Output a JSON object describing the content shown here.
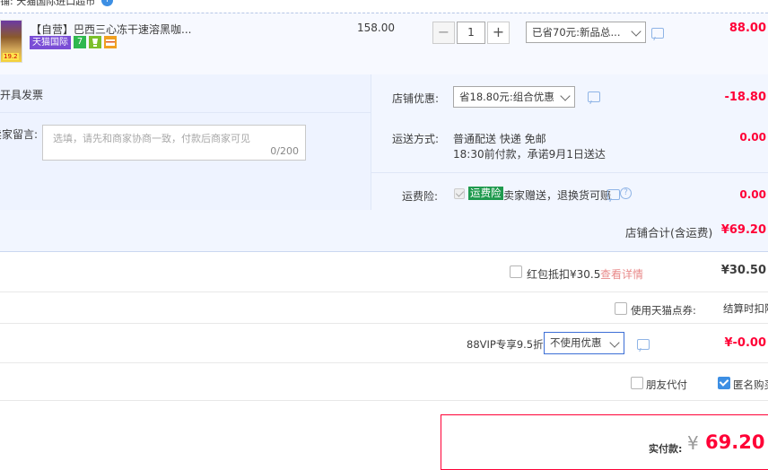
{
  "shop": {
    "label": "铺: 天猫国际进口超市",
    "info_glyph": "i"
  },
  "item": {
    "thumb_tag": "19.2",
    "title": "【自营】巴西三心冻干速溶黑咖...",
    "badge_tmall": "天猫国际",
    "badge_icons": [
      "7",
      "cup",
      "card"
    ],
    "unit_price": "158.00",
    "quantity": "1",
    "minus": "−",
    "plus": "+",
    "discount_select": "已省70元:新品总...",
    "subtotal": "88.00"
  },
  "invoice": {
    "label": "开具发票"
  },
  "message": {
    "label": "卖家留言:",
    "placeholder": "选填，请先和商家协商一致，付款后商家可见",
    "counter": "0/200"
  },
  "shop_promo": {
    "label": "店铺优惠:",
    "select": "省18.80元:组合优惠",
    "amount": "-18.80"
  },
  "shipping": {
    "label": "运送方式:",
    "method": "普通配送 快递 免邮",
    "promise": "18:30前付款，承诺9月1日送达",
    "amount": "0.00"
  },
  "insurance": {
    "label": "运费险:",
    "tag": "运费险",
    "desc": "卖家赠送，退换货可赔",
    "amount": "0.00"
  },
  "shop_total": {
    "label": "店铺合计(含运费)",
    "amount": "¥69.20"
  },
  "red_packet": {
    "label": "红包抵扣¥30.5",
    "link": "查看详情",
    "amount": "¥30.50"
  },
  "tmall_points": {
    "label": "使用天猫点券:",
    "note": "结算时扣除"
  },
  "vip": {
    "label": "88VIP专享9.5折",
    "select": "不使用优惠",
    "amount": "¥-0.00"
  },
  "options": {
    "friend_pay": "朋友代付",
    "anonymous": "匿名购买"
  },
  "pay": {
    "label": "实付款:",
    "currency": "¥",
    "amount": "69.20"
  },
  "colors": {
    "accent_red": "#ff0036",
    "link_blue": "#3d8fe4",
    "panel_bg": "#f2f6ff"
  }
}
